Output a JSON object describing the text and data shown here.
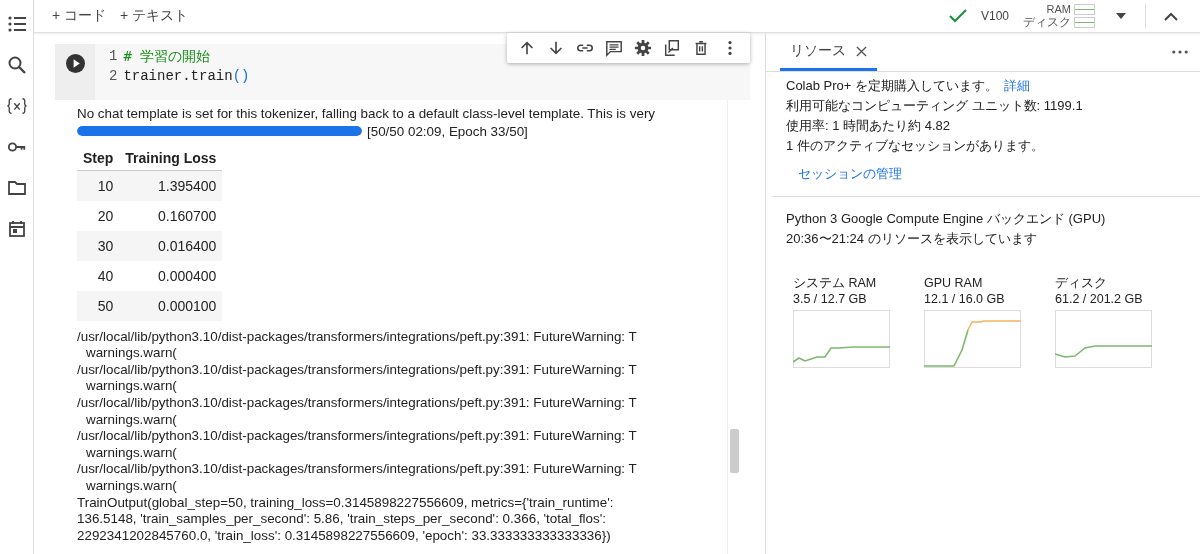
{
  "toolbar": {
    "buttons": [
      "+ コード",
      "+ テキスト"
    ]
  },
  "runtime": {
    "status": "V100",
    "ram_label": "RAM",
    "disk_label": "ディスク"
  },
  "cell": {
    "lines": [
      {
        "number": "1",
        "parts": [
          {
            "text": "# 学習の開始",
            "kind": "comment"
          }
        ]
      },
      {
        "number": "2",
        "parts": [
          {
            "text": "trainer.train",
            "kind": "plain"
          },
          {
            "text": "()",
            "kind": "paren"
          }
        ]
      }
    ]
  },
  "output": {
    "notice": "No chat template is set for this tokenizer, falling back to a default class-level template. This is very",
    "progress": {
      "level": 1,
      "label": "[50/50 02:09, Epoch 33/50]"
    },
    "table": {
      "columns": [
        "Step",
        "Training Loss"
      ],
      "rows": [
        [
          "10",
          "1.395400"
        ],
        [
          "20",
          "0.160700"
        ],
        [
          "30",
          "0.016400"
        ],
        [
          "40",
          "0.000400"
        ],
        [
          "50",
          "0.000100"
        ]
      ]
    },
    "log_lines": [
      {
        "kind": "path",
        "text": "/usr/local/lib/python3.10/dist-packages/transformers/integrations/peft.py:391: FutureWarning: T"
      },
      {
        "kind": "call",
        "text": "warnings.warn("
      },
      {
        "kind": "path",
        "text": "/usr/local/lib/python3.10/dist-packages/transformers/integrations/peft.py:391: FutureWarning: T"
      },
      {
        "kind": "call",
        "text": "warnings.warn("
      },
      {
        "kind": "path",
        "text": "/usr/local/lib/python3.10/dist-packages/transformers/integrations/peft.py:391: FutureWarning: T"
      },
      {
        "kind": "call",
        "text": "warnings.warn("
      },
      {
        "kind": "path",
        "text": "/usr/local/lib/python3.10/dist-packages/transformers/integrations/peft.py:391: FutureWarning: T"
      },
      {
        "kind": "call",
        "text": "warnings.warn("
      },
      {
        "kind": "path",
        "text": "/usr/local/lib/python3.10/dist-packages/transformers/integrations/peft.py:391: FutureWarning: T"
      },
      {
        "kind": "call",
        "text": "warnings.warn("
      }
    ],
    "result_lines": [
      "TrainOutput(global_step=50, training_loss=0.3145898227556609, metrics={'train_runtime':",
      "136.5148, 'train_samples_per_second': 5.86, 'train_steps_per_second': 0.366, 'total_flos':",
      "2292341202845760.0, 'train_loss': 0.3145898227556609, 'epoch': 33.333333333333336})"
    ]
  },
  "resources_panel": {
    "tab": {
      "label": "リソース",
      "selected": true
    },
    "subscription": "Colab Pro+ を定期購入しています。",
    "details_link": "詳細",
    "units": "利用可能なコンピューティング ユニット数: 1199.1",
    "usage": "使用率: 1 時間あたり約 4.82",
    "sessions": "1 件のアクティブなセッションがあります。",
    "manage_link": "セッションの管理",
    "backend": "Python 3 Google Compute Engine バックエンド (GPU)",
    "range": "20:36〜21:24 のリソースを表示しています",
    "meters": [
      {
        "name": "システム RAM",
        "reading": "3.5 / 12.7 GB"
      },
      {
        "name": "GPU RAM",
        "reading": "12.1 / 16.0 GB"
      },
      {
        "name": "ディスク",
        "reading": "61.2 / 201.2 GB"
      }
    ]
  }
}
